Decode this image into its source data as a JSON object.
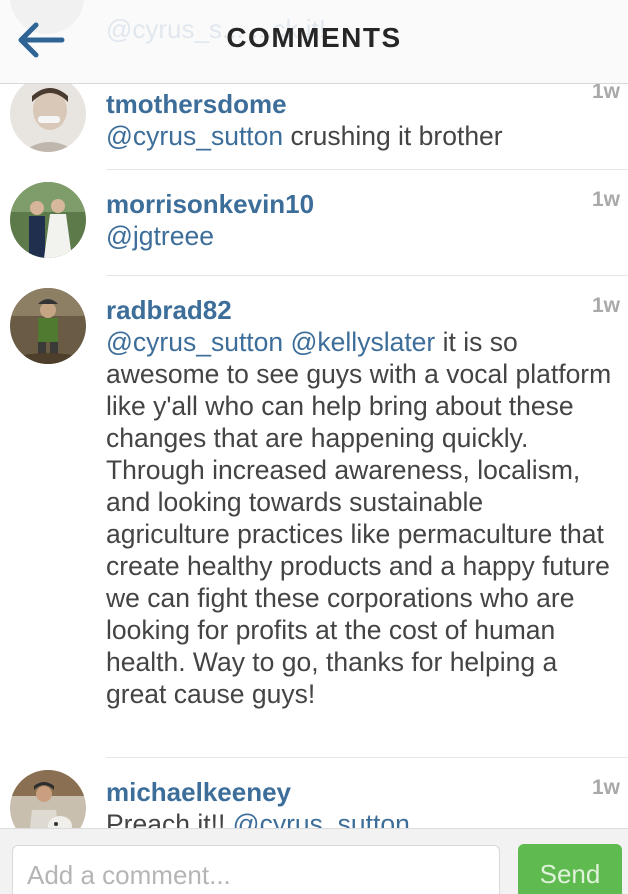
{
  "header": {
    "title": "COMMENTS",
    "ghost_comment": "@cyrus_s... ...ck it!"
  },
  "comments": [
    {
      "username": "tmothersdome",
      "time": "1w",
      "avatar_icon": "avatar-smiling-man",
      "segments": [
        {
          "text": "@cyrus_sutton",
          "mention": true
        },
        {
          "text": " crushing it brother",
          "mention": false
        }
      ]
    },
    {
      "username": "morrisonkevin10",
      "time": "1w",
      "avatar_icon": "avatar-wedding-couple",
      "segments": [
        {
          "text": "@jgtreee",
          "mention": true
        }
      ]
    },
    {
      "username": "radbrad82",
      "time": "1w",
      "avatar_icon": "avatar-farmer",
      "segments": [
        {
          "text": "@cyrus_sutton",
          "mention": true
        },
        {
          "text": " ",
          "mention": false
        },
        {
          "text": "@kellyslater",
          "mention": true
        },
        {
          "text": " it is so awesome to see guys with a vocal platform like y'all who can help bring about these changes that are happening quickly. Through increased awareness, localism, and looking towards sustainable agriculture practices like permaculture that create healthy products and a happy future we can fight these corporations who are looking for profits at the cost of human health. Way to go, thanks for helping a great cause guys!",
          "mention": false
        }
      ]
    },
    {
      "username": "michaelkeeney",
      "time": "1w",
      "avatar_icon": "avatar-man-with-dog",
      "segments": [
        {
          "text": "Preach it!! ",
          "mention": false
        },
        {
          "text": "@cyrus_sutton",
          "mention": true
        }
      ]
    }
  ],
  "composer": {
    "placeholder": "Add a comment...",
    "value": "",
    "send_label": "Send"
  },
  "colors": {
    "accent_link": "#3d6e9a",
    "send_green": "#5fba4f",
    "timestamp_gray": "#a9a9a9"
  }
}
